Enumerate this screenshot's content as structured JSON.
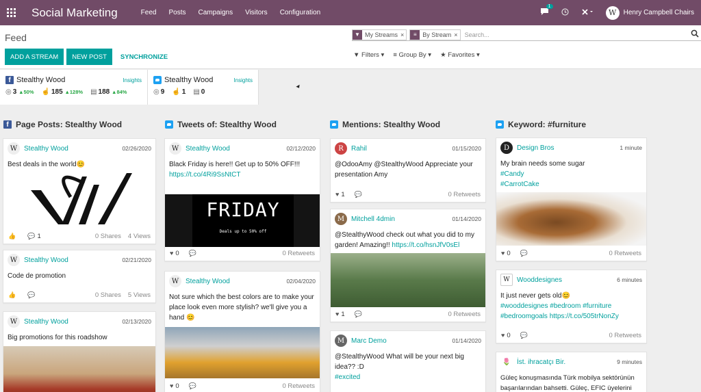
{
  "topbar": {
    "app_title": "Social Marketing",
    "menu": [
      "Feed",
      "Posts",
      "Campaigns",
      "Visitors",
      "Configuration"
    ],
    "chat_count": "1",
    "user_name": "Henry Campbell Chairs"
  },
  "control_panel": {
    "breadcrumb": "Feed",
    "buttons": {
      "add_stream": "ADD A STREAM",
      "new_post": "NEW POST",
      "synchronize": "SYNCHRONIZE"
    },
    "facets": [
      "My Streams",
      "By Stream"
    ],
    "search_placeholder": "Search...",
    "filters": "Filters",
    "group_by": "Group By",
    "favorites": "Favorites"
  },
  "accounts": [
    {
      "network": "facebook",
      "name": "Stealthy Wood",
      "insights": "Insights",
      "stats": [
        {
          "value": "3",
          "trend": "50%"
        },
        {
          "value": "185",
          "trend": "128%"
        },
        {
          "value": "188",
          "trend": "84%"
        }
      ]
    },
    {
      "network": "twitter",
      "name": "Stealthy Wood",
      "insights": "Insights",
      "stats": [
        {
          "value": "9"
        },
        {
          "value": "1"
        },
        {
          "value": "0"
        }
      ]
    }
  ],
  "columns": [
    {
      "title": "Page Posts: Stealthy Wood",
      "posts": [
        {
          "author": "Stealthy Wood",
          "date": "02/26/2020",
          "text": "Best deals in the world😊",
          "likes": "",
          "comments": "1",
          "shares": "0 Shares",
          "views": "4 Views"
        },
        {
          "author": "Stealthy Wood",
          "date": "02/21/2020",
          "text": "Code de promotion",
          "likes": "",
          "comments": "",
          "shares": "0 Shares",
          "views": "5 Views"
        },
        {
          "author": "Stealthy Wood",
          "date": "02/13/2020",
          "text": "Big promotions for this roadshow"
        }
      ]
    },
    {
      "title": "Tweets of: Stealthy Wood",
      "posts": [
        {
          "author": "Stealthy Wood",
          "date": "02/12/2020",
          "text": "Black Friday is here!! Get up to 50% OFF!!!",
          "link": "https://t.co/4Ri9SsNtCT",
          "image_title": "FRIDAY",
          "image_sub": "Deals up to 50% off",
          "likes": "0",
          "retweets": "0 Retweets"
        },
        {
          "author": "Stealthy Wood",
          "date": "02/04/2020",
          "text": "Not sure which the best colors are to make your place look even more stylish? we'll give you a hand 😊",
          "likes": "0",
          "retweets": "0 Retweets"
        }
      ]
    },
    {
      "title": "Mentions: Stealthy Wood",
      "posts": [
        {
          "author": "Rahil",
          "date": "01/15/2020",
          "text": "@OdooAmy @StealthyWood Appreciate your presentation Amy",
          "likes": "1",
          "retweets": "0 Retweets"
        },
        {
          "author": "Mitchell 4dmin",
          "date": "01/14/2020",
          "text": "@StealthyWood check out what you did to my garden! Amazing!!",
          "link": "https://t.co/hsnJfV0sEl",
          "likes": "1",
          "retweets": "0 Retweets"
        },
        {
          "author": "Marc Demo",
          "date": "01/14/2020",
          "text": "@StealthyWood What will be your next big idea?? :D",
          "hashtags": "#excited",
          "likes": "",
          "retweets": "0 Retweets"
        }
      ]
    },
    {
      "title": "Keyword: #furniture",
      "posts": [
        {
          "author": "Design Bros",
          "date": "1 minute",
          "text": "My brain needs some sugar",
          "hashtags": "#Candy",
          "hashtags2": "#CarrotCake",
          "likes": "0",
          "retweets": "0 Retweets"
        },
        {
          "author": "Wooddesignes",
          "date": "6 minutes",
          "text": "It just never gets old😊",
          "hashtags": "#wooddesignes #bedroom #furniture",
          "hashtags2": "#bedroomgoals https://t.co/505trNonZy",
          "likes": "0",
          "retweets": "0 Retweets"
        },
        {
          "author": "İst. ihracatçı Bir.",
          "date": "9 minutes",
          "text": "Güleç konuşmasında Türk mobilya sektörünün başarılarından bahsetti. Güleç, EFIC üyelerini"
        }
      ]
    }
  ],
  "colors": {
    "topbar": "#714b67",
    "accent": "#00a09d",
    "facebook": "#3b5998",
    "twitter": "#1da1f2"
  }
}
